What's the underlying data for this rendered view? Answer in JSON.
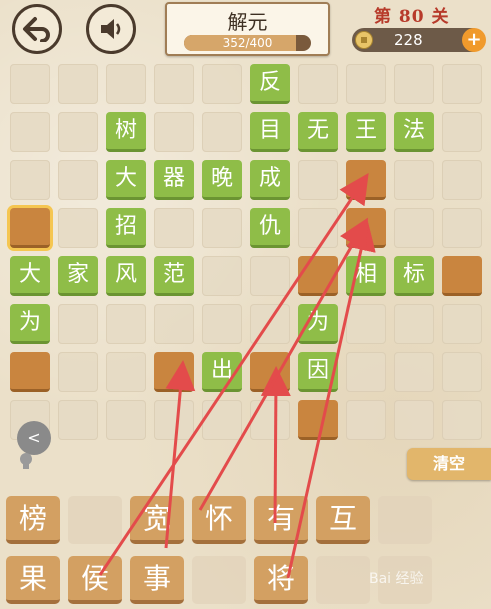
{
  "header": {
    "title": "解元",
    "progress_text": "352/400",
    "progress_fraction": 0.88,
    "level": "第 80 关",
    "coins": "228"
  },
  "board": {
    "green_cells": [
      {
        "char": "反",
        "col": 5,
        "row": 0
      },
      {
        "char": "树",
        "col": 2,
        "row": 1
      },
      {
        "char": "目",
        "col": 5,
        "row": 1
      },
      {
        "char": "无",
        "col": 6,
        "row": 1
      },
      {
        "char": "王",
        "col": 7,
        "row": 1
      },
      {
        "char": "法",
        "col": 8,
        "row": 1
      },
      {
        "char": "大",
        "col": 2,
        "row": 2
      },
      {
        "char": "器",
        "col": 3,
        "row": 2
      },
      {
        "char": "晚",
        "col": 4,
        "row": 2
      },
      {
        "char": "成",
        "col": 5,
        "row": 2
      },
      {
        "char": "招",
        "col": 2,
        "row": 3
      },
      {
        "char": "仇",
        "col": 5,
        "row": 3
      },
      {
        "char": "大",
        "col": 0,
        "row": 4
      },
      {
        "char": "家",
        "col": 1,
        "row": 4
      },
      {
        "char": "风",
        "col": 2,
        "row": 4
      },
      {
        "char": "范",
        "col": 3,
        "row": 4
      },
      {
        "char": "相",
        "col": 7,
        "row": 4
      },
      {
        "char": "标",
        "col": 8,
        "row": 4
      },
      {
        "char": "为",
        "col": 0,
        "row": 5
      },
      {
        "char": "为",
        "col": 6,
        "row": 5
      },
      {
        "char": "出",
        "col": 4,
        "row": 6
      },
      {
        "char": "因",
        "col": 6,
        "row": 6
      }
    ],
    "slots": [
      {
        "col": 7,
        "row": 2
      },
      {
        "col": 0,
        "row": 3,
        "selected": true
      },
      {
        "col": 7,
        "row": 3
      },
      {
        "col": 6,
        "row": 4
      },
      {
        "col": 9,
        "row": 4
      },
      {
        "col": 0,
        "row": 6
      },
      {
        "col": 3,
        "row": 6
      },
      {
        "col": 5,
        "row": 6
      },
      {
        "col": 6,
        "row": 7
      }
    ]
  },
  "controls": {
    "back_arrow": "<",
    "clear_label": "清空"
  },
  "tray": {
    "row1": [
      "榜",
      "",
      "宽",
      "怀",
      "有",
      "互",
      ""
    ],
    "row2": [
      "果",
      "侯",
      "事",
      "",
      "将",
      "",
      ""
    ]
  },
  "watermark": "Bai 经验",
  "colors": {
    "tile_green": "#8fbd48",
    "slot_orange": "#c9853f",
    "arrow_red": "#e34b4b"
  }
}
